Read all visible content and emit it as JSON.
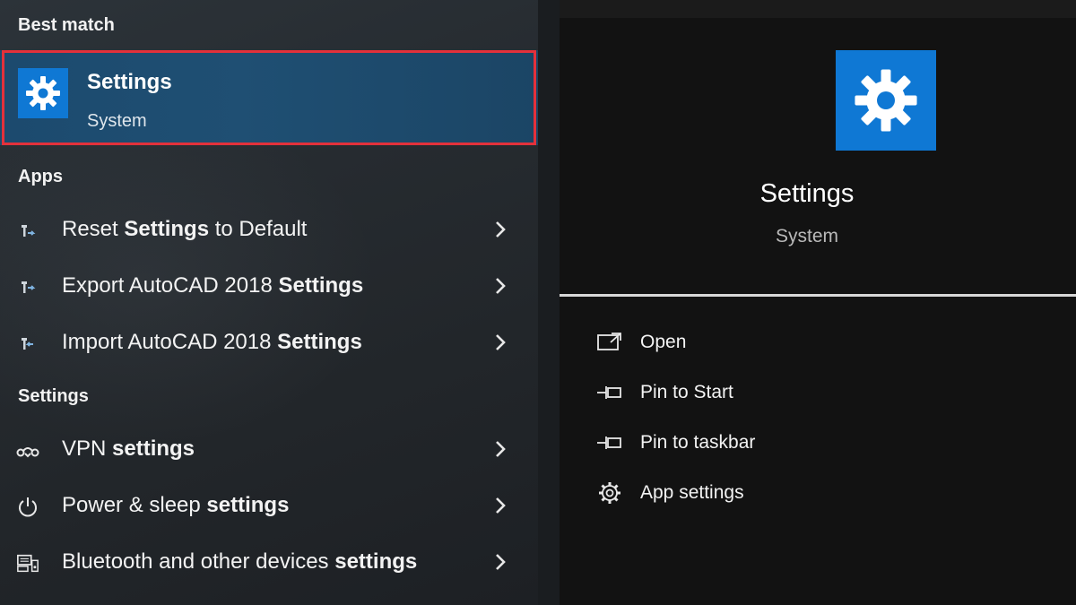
{
  "left_panel": {
    "best_match_heading": "Best match",
    "best_match": {
      "title": "Settings",
      "subtitle": "System",
      "icon": "gear-icon"
    },
    "apps_heading": "Apps",
    "apps": [
      {
        "pre": "Reset ",
        "bold": "Settings",
        "post": " to Default",
        "icon": "app-tool-icon"
      },
      {
        "pre": "Export AutoCAD 2018 ",
        "bold": "Settings",
        "post": "",
        "icon": "app-tool-icon"
      },
      {
        "pre": "Import AutoCAD 2018 ",
        "bold": "Settings",
        "post": "",
        "icon": "app-tool-icon"
      }
    ],
    "settings_heading": "Settings",
    "settings": [
      {
        "pre": "VPN ",
        "bold": "settings",
        "post": "",
        "icon": "vpn-icon"
      },
      {
        "pre": "Power & sleep ",
        "bold": "settings",
        "post": "",
        "icon": "power-icon"
      },
      {
        "pre": "Bluetooth and other devices ",
        "bold": "settings",
        "post": "",
        "icon": "devices-icon"
      }
    ]
  },
  "right_panel": {
    "title": "Settings",
    "subtitle": "System",
    "icon": "gear-icon",
    "actions": [
      {
        "label": "Open",
        "icon": "open-icon"
      },
      {
        "label": "Pin to Start",
        "icon": "pin-icon"
      },
      {
        "label": "Pin to taskbar",
        "icon": "pin-icon"
      },
      {
        "label": "App settings",
        "icon": "gear-outline-icon"
      }
    ]
  },
  "colors": {
    "accent_blue": "#0f78d4",
    "highlight_border": "#e3313b",
    "selected_row": "#1f4f73"
  }
}
